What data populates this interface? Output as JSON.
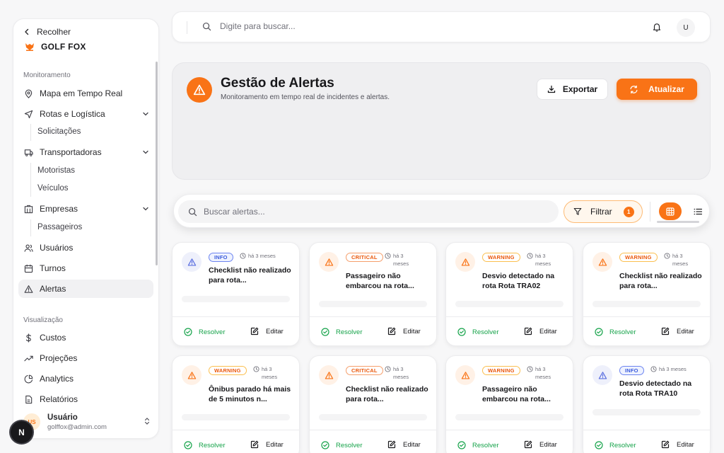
{
  "sidebar": {
    "collapse_label": "Recolher",
    "brand": "GOLF FOX",
    "section_monitoring": "Monitoramento",
    "items": [
      {
        "label": "Mapa em Tempo Real",
        "icon": "map-pin-icon"
      },
      {
        "label": "Rotas e Logística",
        "icon": "navigation-icon"
      },
      {
        "label": "Solicitações"
      },
      {
        "label": "Transportadoras",
        "icon": "truck-icon"
      },
      {
        "label": "Motoristas"
      },
      {
        "label": "Veículos"
      },
      {
        "label": "Empresas",
        "icon": "building-icon"
      },
      {
        "label": "Passageiros"
      },
      {
        "label": "Usuários",
        "icon": "users-icon"
      },
      {
        "label": "Turnos",
        "icon": "calendar-icon"
      },
      {
        "label": "Alertas",
        "icon": "alert-triangle-icon"
      }
    ],
    "section_visualization": "Visualização",
    "viz_items": [
      {
        "label": "Custos",
        "icon": "dollar-icon"
      },
      {
        "label": "Projeções",
        "icon": "trending-up-icon"
      },
      {
        "label": "Analytics",
        "icon": "pie-chart-icon"
      },
      {
        "label": "Relatórios",
        "icon": "file-text-icon"
      }
    ],
    "user": {
      "initials": "US",
      "name": "Usuário",
      "email": "golffox@admin.com"
    }
  },
  "topbar": {
    "search_placeholder": "Digite para buscar...",
    "avatar_initial": "U"
  },
  "next_badge": "N",
  "header": {
    "title": "Gestão de Alertas",
    "subtitle": "Monitoramento em tempo real de incidentes e alertas.",
    "export_label": "Exportar",
    "refresh_label": "Atualizar"
  },
  "filters": {
    "search_placeholder": "Buscar alertas...",
    "filter_label": "Filtrar",
    "filter_count": "1"
  },
  "colors": {
    "accent": "#f97316",
    "success": "#16a34a",
    "info": "#3b5bdb"
  },
  "card_actions": {
    "resolve": "Resolver",
    "edit": "Editar"
  },
  "alerts": [
    {
      "severity": "INFO",
      "time": "há 3 meses",
      "title": "Checklist não realizado para rota..."
    },
    {
      "severity": "CRITICAL",
      "time": "há 3 meses",
      "title": "Passageiro não embarcou na rota..."
    },
    {
      "severity": "WARNING",
      "time": "há 3 meses",
      "title": "Desvio detectado na rota Rota TRA02"
    },
    {
      "severity": "WARNING",
      "time": "há 3 meses",
      "title": "Checklist não realizado para rota..."
    },
    {
      "severity": "WARNING",
      "time": "há 3 meses",
      "title": "Ônibus parado há mais de 5 minutos n..."
    },
    {
      "severity": "CRITICAL",
      "time": "há 3 meses",
      "title": "Checklist não realizado para rota..."
    },
    {
      "severity": "WARNING",
      "time": "há 3 meses",
      "title": "Passageiro não embarcou na rota..."
    },
    {
      "severity": "INFO",
      "time": "há 3 meses",
      "title": "Desvio detectado na rota Rota TRA10"
    }
  ]
}
